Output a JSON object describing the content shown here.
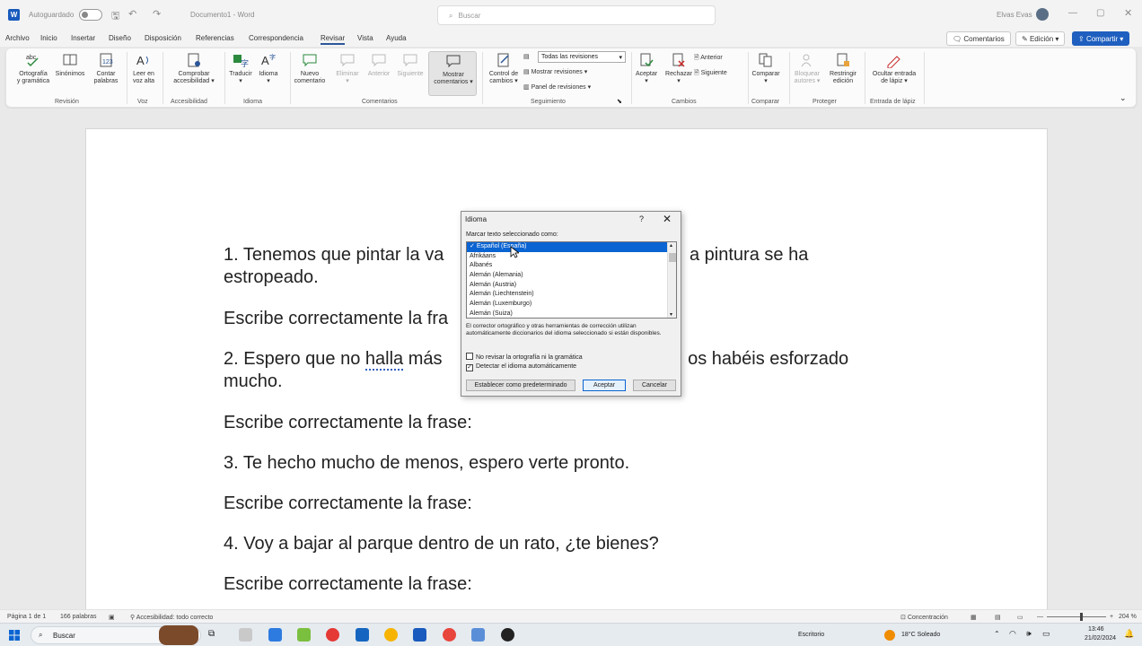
{
  "titlebar": {
    "autosave_label": "Autoguardado",
    "doc_title": "Documento1 - Word",
    "search_placeholder": "Buscar",
    "user_name": "Elvas Evas"
  },
  "menu": {
    "tabs": [
      "Archivo",
      "Inicio",
      "Insertar",
      "Diseño",
      "Disposición",
      "Referencias",
      "Correspondencia",
      "Revisar",
      "Vista",
      "Ayuda"
    ],
    "active": "Revisar",
    "comments_btn": "Comentarios",
    "edit_btn": "Edición",
    "share_btn": "Compartir"
  },
  "ribbon": {
    "buttons": {
      "ortografia": [
        "Ortografía",
        "y gramática"
      ],
      "sinonimos": [
        "Sinónimos"
      ],
      "contar": [
        "Contar",
        "palabras"
      ],
      "leer": [
        "Leer en",
        "voz alta"
      ],
      "comprobar": [
        "Comprobar",
        "accesibilidad ▾"
      ],
      "traducir": [
        "Traducir",
        "▾"
      ],
      "idioma": [
        "Idioma",
        "▾"
      ],
      "nuevo_comentario": [
        "Nuevo",
        "comentario"
      ],
      "eliminar": [
        "Eliminar",
        "▾"
      ],
      "anterior": [
        "Anterior"
      ],
      "siguiente": [
        "Siguiente"
      ],
      "mostrar_comentarios": [
        "Mostrar",
        "comentarios ▾"
      ],
      "control_cambios": [
        "Control de",
        "cambios ▾"
      ],
      "aceptar": [
        "Aceptar",
        "▾"
      ],
      "rechazar": [
        "Rechazar",
        "▾"
      ],
      "comparar": [
        "Comparar",
        "▾"
      ],
      "bloquear": [
        "Bloquear",
        "autores ▾"
      ],
      "restringir": [
        "Restringir",
        "edición"
      ],
      "ocultar": [
        "Ocultar entrada",
        "de lápiz ▾"
      ]
    },
    "small": {
      "todas": "Todas las revisiones",
      "mostrar_revisiones": "Mostrar revisiones ▾",
      "panel_revisiones": "Panel de revisiones ▾",
      "cambios_anterior": "Anterior",
      "cambios_siguiente": "Siguiente"
    },
    "groups": [
      "Revisión",
      "Voz",
      "Accesibilidad",
      "Idioma",
      "Comentarios",
      "Seguimiento",
      "Cambios",
      "Comparar",
      "Proteger",
      "Entrada de lápiz"
    ]
  },
  "document": {
    "l1a": "1. Tenemos que pintar la va",
    "l1b": "a pintura se ha",
    "l1c": "estropeado.",
    "prompt": "Escribe correctamente la fra",
    "l2a": "2. Espero que no ",
    "l2_err": "halla",
    "l2b": " más",
    "l2c": ", os habéis esforzado",
    "l2d": "mucho.",
    "prompt_full": "Escribe correctamente la frase:",
    "l3": "3. Te hecho mucho de menos, espero verte pronto.",
    "l4": "4. Voy a bajar al parque dentro de un rato, ¿te bienes?"
  },
  "dialog": {
    "title": "Idioma",
    "help": "?",
    "close": "✕",
    "list_label": "Marcar texto seleccionado como:",
    "languages": [
      "Español (España)",
      "Afrikáans",
      "Albanés",
      "Alemán (Alemania)",
      "Alemán (Austria)",
      "Alemán (Liechtenstein)",
      "Alemán (Luxemburgo)",
      "Alemán (Suiza)"
    ],
    "description": "El corrector ortográfico y otras herramientas de corrección utilizan automáticamente diccionarios del idioma seleccionado si están disponibles.",
    "no_revisar": "No revisar la ortografía ni la gramática",
    "detectar": "Detectar el idioma automáticamente",
    "btn_default": "Establecer como predeterminado",
    "btn_ok": "Aceptar",
    "btn_cancel": "Cancelar"
  },
  "status": {
    "page": "Página 1 de 1",
    "words": "166 palabras",
    "accessibility": "Accesibilidad: todo correcto",
    "focus": "Concentración",
    "zoom": "204 %"
  },
  "taskbar": {
    "search": "Buscar",
    "desktop": "Escritorio",
    "weather": "18°C  Soleado",
    "time": "13:46",
    "date": "21/02/2024"
  }
}
